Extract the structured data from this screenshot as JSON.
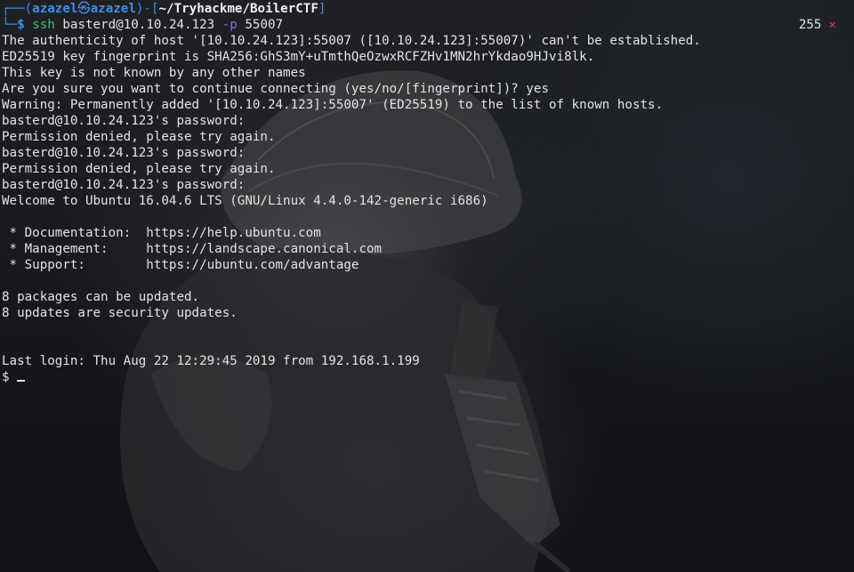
{
  "prompt": {
    "open": "┌──(",
    "user": "azazel",
    "at_icon": "㉿",
    "host": "azazel",
    "mid": ")-[",
    "path": "~/Tryhackme/BoilerCTF",
    "close": "]",
    "second_prefix": "└─",
    "dollar": "$",
    "cmd_name": "ssh",
    "cmd_target": "basterd@10.10.24.123",
    "cmd_flag": "-p",
    "cmd_port": "55007"
  },
  "status": {
    "exit_code": "255",
    "fail_glyph": "✕"
  },
  "output": [
    "The authenticity of host '[10.10.24.123]:55007 ([10.10.24.123]:55007)' can't be established.",
    "ED25519 key fingerprint is SHA256:GhS3mY+uTmthQeOzwxRCFZHv1MN2hrYkdao9HJvi8lk.",
    "This key is not known by any other names",
    "Are you sure you want to continue connecting (yes/no/[fingerprint])? yes",
    "Warning: Permanently added '[10.10.24.123]:55007' (ED25519) to the list of known hosts.",
    "basterd@10.10.24.123's password: ",
    "Permission denied, please try again.",
    "basterd@10.10.24.123's password: ",
    "Permission denied, please try again.",
    "basterd@10.10.24.123's password: ",
    "Welcome to Ubuntu 16.04.6 LTS (GNU/Linux 4.4.0-142-generic i686)",
    "",
    " * Documentation:  https://help.ubuntu.com",
    " * Management:     https://landscape.canonical.com",
    " * Support:        https://ubuntu.com/advantage",
    "",
    "8 packages can be updated.",
    "8 updates are security updates.",
    "",
    "",
    "Last login: Thu Aug 22 12:29:45 2019 from 192.168.1.199"
  ],
  "remote_prompt": "$ ",
  "colors": {
    "prompt_blue": "#3f8ee8",
    "command_green": "#3fc07a",
    "flag_purple": "#a061e3",
    "error_red": "#e0413a",
    "text": "#e4e4e4"
  }
}
